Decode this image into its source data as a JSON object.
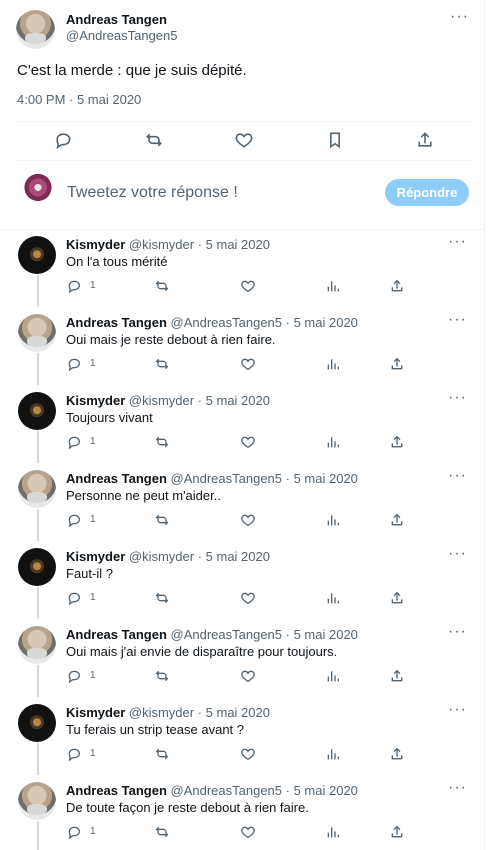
{
  "main_tweet": {
    "author_name": "Andreas Tangen",
    "author_handle": "@AndreasTangen5",
    "text": "C'est la merde : que je suis dépité.",
    "datetime": "4:00 PM · 5 mai 2020"
  },
  "reply_box": {
    "placeholder": "Tweetez votre réponse !",
    "button": "Répondre"
  },
  "replies": [
    {
      "name": "Kismyder",
      "handle": "@kismyder",
      "date": "· 5 mai 2020",
      "text": "On l'a tous mérité",
      "reply_count": "1"
    },
    {
      "name": "Andreas Tangen",
      "handle": "@AndreasTangen5",
      "date": "· 5 mai 2020",
      "text": "Oui mais je reste debout à rien faire.",
      "reply_count": "1"
    },
    {
      "name": "Kismyder",
      "handle": "@kismyder",
      "date": "· 5 mai 2020",
      "text": "Toujours vivant",
      "reply_count": "1"
    },
    {
      "name": "Andreas Tangen",
      "handle": "@AndreasTangen5",
      "date": "· 5 mai 2020",
      "text": "Personne ne peut m'aider..",
      "reply_count": "1"
    },
    {
      "name": "Kismyder",
      "handle": "@kismyder",
      "date": "· 5 mai 2020",
      "text": "Faut-il ?",
      "reply_count": "1"
    },
    {
      "name": "Andreas Tangen",
      "handle": "@AndreasTangen5",
      "date": "· 5 mai 2020",
      "text": "Oui mais j'ai envie de disparaître pour toujours.",
      "reply_count": "1"
    },
    {
      "name": "Kismyder",
      "handle": "@kismyder",
      "date": "· 5 mai 2020",
      "text": "Tu ferais un strip tease avant ?",
      "reply_count": "1"
    },
    {
      "name": "Andreas Tangen",
      "handle": "@AndreasTangen5",
      "date": "· 5 mai 2020",
      "text": "De toute façon je reste debout à rien faire.",
      "reply_count": "1"
    }
  ],
  "icons": {
    "more": "more-dots-icon",
    "reply": "reply-icon",
    "retweet": "retweet-icon",
    "like": "heart-icon",
    "bookmark": "bookmark-icon",
    "share": "share-icon",
    "analytics": "analytics-icon"
  },
  "colors": {
    "text": "#0f1419",
    "secondary": "#536471",
    "border": "#eff3f4",
    "button": "#8ecdf8"
  }
}
